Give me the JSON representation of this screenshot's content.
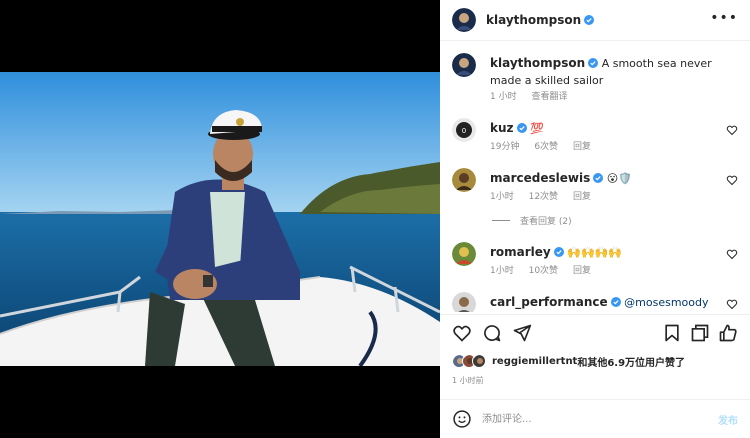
{
  "post": {
    "username": "klaythompson",
    "caption": "A smooth sea never made a skilled sailor",
    "caption_time": "1 小时",
    "see_translation": "查看翻译"
  },
  "comments": [
    {
      "username": "kuz",
      "text": "💯",
      "time": "19分钟",
      "likes": "6次赞",
      "reply": "回复"
    },
    {
      "username": "marcedeslewis",
      "text": "😮🛡️",
      "time": "1小时",
      "likes": "12次赞",
      "reply": "回复"
    },
    {
      "username": "romarley",
      "text": "🙌🙌🙌🙌",
      "time": "1小时",
      "likes": "10次赞",
      "reply": "回复"
    },
    {
      "username": "carl_performance",
      "mention": "@mosesmoody"
    }
  ],
  "view_replies": "查看回复 (2)",
  "likes_line": {
    "user": "reggiemillertnt",
    "rest": "和其他6.9万位用户赞了"
  },
  "post_time": "1 小时前",
  "add_comment": {
    "placeholder": "添加评论...",
    "post_label": "发布"
  },
  "icons": [
    "more-icon",
    "verified-icon",
    "heart-icon",
    "comment-icon",
    "share-icon",
    "bookmark-icon",
    "collab-icon",
    "emoji-icon"
  ],
  "colors": {
    "verified": "#3897f0",
    "link": "#00376b",
    "muted": "#8e8e8e",
    "post_disabled": "#b2dffc"
  }
}
